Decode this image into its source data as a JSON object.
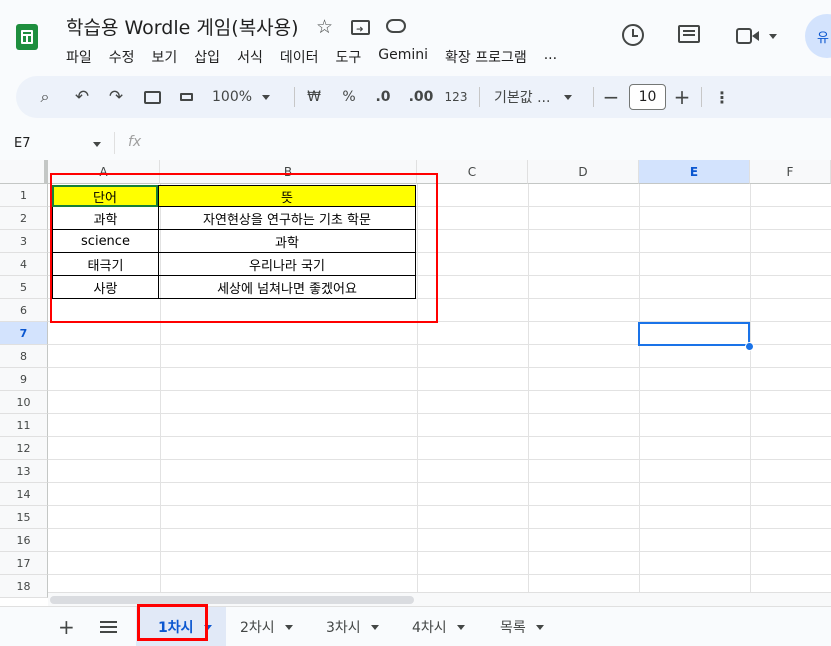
{
  "doc": {
    "title": "학습용 Wordle 게임(복사용)"
  },
  "menu": [
    "파일",
    "수정",
    "보기",
    "삽입",
    "서식",
    "데이터",
    "도구",
    "Gemini",
    "확장 프로그램",
    "..."
  ],
  "toolbar": {
    "zoom": "100%",
    "currency": "₩",
    "percent": "%",
    "dec_less": ".0",
    "dec_more": ".00",
    "format_123": "123",
    "font": "기본값 ...",
    "font_size": "10"
  },
  "formula_bar": {
    "cell_ref": "E7",
    "fx": "fx",
    "value": ""
  },
  "avatar_text": "유",
  "columns": [
    "A",
    "B",
    "C",
    "D",
    "E",
    "F"
  ],
  "rows": [
    "1",
    "2",
    "3",
    "4",
    "5",
    "6",
    "7",
    "8",
    "9",
    "10",
    "11",
    "12",
    "13",
    "14",
    "15",
    "16",
    "17",
    "18"
  ],
  "table": {
    "header": {
      "a": "단어",
      "b": "뜻"
    },
    "rows": [
      {
        "a": "과학",
        "b": "자연현상을 연구하는 기초 학문"
      },
      {
        "a": "science",
        "b": "과학"
      },
      {
        "a": "태극기",
        "b": "우리나라 국기"
      },
      {
        "a": "사랑",
        "b": "세상에 넘쳐나면 좋겠어요"
      }
    ]
  },
  "selected_cell": "E7",
  "sheet_tabs": [
    "1차시",
    "2차시",
    "3차시",
    "4차시",
    "목록"
  ],
  "active_tab": "1차시",
  "colors": {
    "highlight_yellow": "#ffff00",
    "annotation_red": "#ff0000",
    "selection_blue": "#1a73e8",
    "active_tab_text": "#0b57d0",
    "sheets_green": "#0f9d58"
  }
}
